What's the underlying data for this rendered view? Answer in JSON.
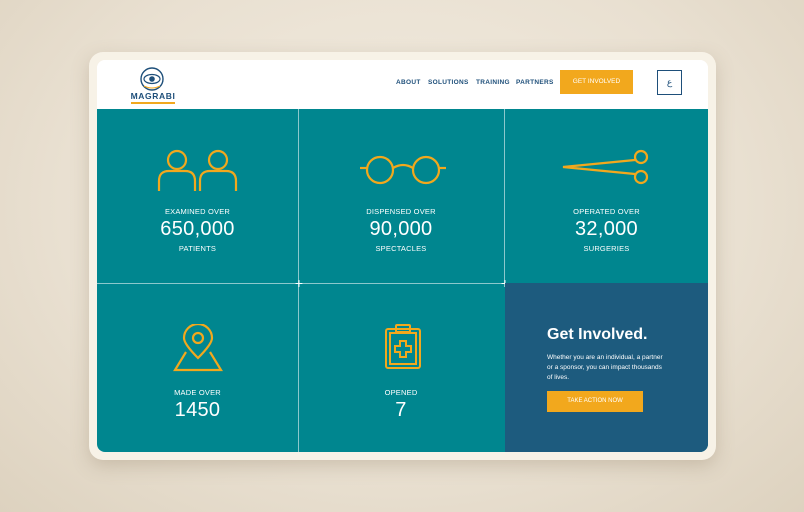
{
  "brand": {
    "name": "MAGRABI"
  },
  "nav": {
    "items": [
      "ABOUT",
      "SOLUTIONS",
      "TRAINING",
      "PARTNERS"
    ],
    "cta": "GET INVOLVED",
    "lang": "ع"
  },
  "stats": [
    {
      "icon": "people-icon",
      "above": "EXAMINED OVER",
      "number": "650,000",
      "below": "PATIENTS"
    },
    {
      "icon": "glasses-icon",
      "above": "DISPENSED OVER",
      "number": "90,000",
      "below": "SPECTACLES"
    },
    {
      "icon": "scissors-icon",
      "above": "OPERATED OVER",
      "number": "32,000",
      "below": "SURGERIES"
    },
    {
      "icon": "map-pin-icon",
      "above": "MADE OVER",
      "number": "1450"
    },
    {
      "icon": "clipboard-medical-icon",
      "above": "OPENED",
      "number": "7"
    }
  ],
  "get_involved": {
    "title": "Get Involved.",
    "text": "Whether you are an individual, a partner or a sponsor, you can impact thousands of lives.",
    "button": "TAKE ACTION NOW"
  },
  "colors": {
    "teal": "#00868f",
    "navy": "#1d5b7e",
    "accent": "#f2a81d",
    "brand_blue": "#1e4f7a"
  }
}
